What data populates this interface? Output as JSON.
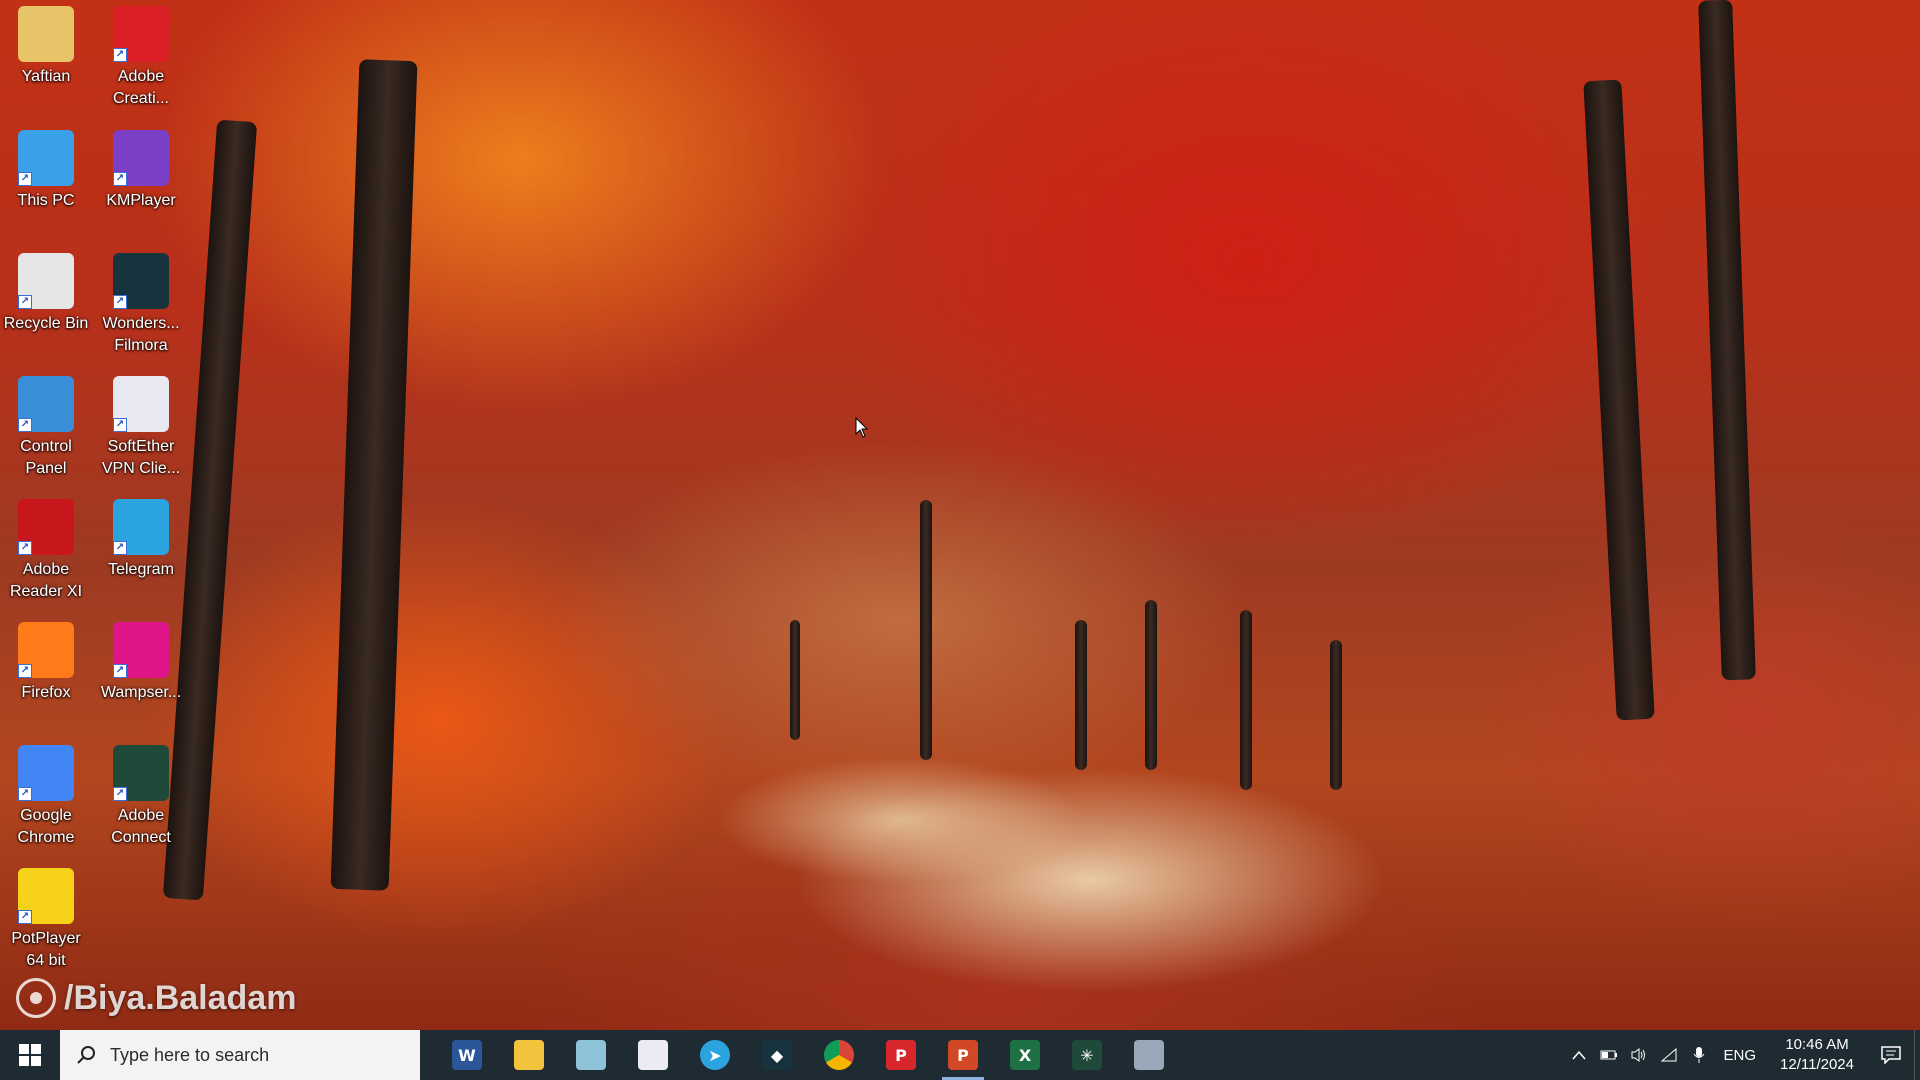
{
  "desktop": {
    "icons": [
      {
        "label": "Yaftian",
        "icon": "folder-user-icon",
        "color": "#e8c468"
      },
      {
        "label": "Adobe\nCreati...",
        "icon": "adobe-creative-cloud-icon",
        "color": "#da1f26"
      },
      {
        "label": "This PC",
        "icon": "this-pc-icon",
        "color": "#3aa0e8"
      },
      {
        "label": "KMPlayer",
        "icon": "kmplayer-icon",
        "color": "#7b3fc8"
      },
      {
        "label": "Recycle Bin",
        "icon": "recycle-bin-icon",
        "color": "#e6e6e6"
      },
      {
        "label": "Wonders...\nFilmora",
        "icon": "filmora-icon",
        "color": "#17333d"
      },
      {
        "label": "Control\nPanel",
        "icon": "control-panel-icon",
        "color": "#3b8fd9"
      },
      {
        "label": "SoftEther\nVPN Clie...",
        "icon": "softether-vpn-icon",
        "color": "#e8e8f0"
      },
      {
        "label": "Adobe\nReader XI",
        "icon": "adobe-reader-icon",
        "color": "#c8161d"
      },
      {
        "label": "Telegram",
        "icon": "telegram-icon",
        "color": "#2aa3df"
      },
      {
        "label": "Firefox",
        "icon": "firefox-icon",
        "color": "#ff7a18"
      },
      {
        "label": "Wampser...",
        "icon": "wampserver-icon",
        "color": "#e0158a"
      },
      {
        "label": "Google\nChrome",
        "icon": "chrome-icon",
        "color": "#4285f4"
      },
      {
        "label": "Adobe\nConnect",
        "icon": "adobe-connect-icon",
        "color": "#1f4a3a"
      },
      {
        "label": "PotPlayer\n64 bit",
        "icon": "potplayer-icon",
        "color": "#f7d21a"
      }
    ],
    "watermark": "/Biya.Baladam"
  },
  "taskbar": {
    "search_placeholder": "Type here to search",
    "pinned": [
      {
        "name": "word",
        "icon": "word-icon",
        "glyph": "W",
        "color": "#2b579a"
      },
      {
        "name": "file-explorer",
        "icon": "folder-icon",
        "glyph": "",
        "color": "#f2c33d"
      },
      {
        "name": "notepad",
        "icon": "notepad-icon",
        "glyph": "",
        "color": "#8fc3d9"
      },
      {
        "name": "softether",
        "icon": "softether-vpn-icon",
        "glyph": "",
        "color": "#ecebf3"
      },
      {
        "name": "telegram",
        "icon": "telegram-icon",
        "glyph": "➤",
        "color": "#2aa3df"
      },
      {
        "name": "filmora",
        "icon": "filmora-icon",
        "glyph": "◆",
        "color": "#17333d"
      },
      {
        "name": "chrome",
        "icon": "chrome-icon",
        "glyph": "",
        "color": "#4285f4"
      },
      {
        "name": "wps-presentation",
        "icon": "wps-presentation-icon",
        "glyph": "P",
        "color": "#d7262c"
      },
      {
        "name": "powerpoint",
        "icon": "powerpoint-icon",
        "glyph": "P",
        "color": "#d24726"
      },
      {
        "name": "excel",
        "icon": "excel-icon",
        "glyph": "X",
        "color": "#1e7145"
      },
      {
        "name": "adobe-connect",
        "icon": "adobe-connect-icon",
        "glyph": "✳",
        "color": "#1f4a3a"
      },
      {
        "name": "camera",
        "icon": "camera-icon",
        "glyph": "",
        "color": "#9aa7b8"
      }
    ],
    "active_index": 8,
    "tray": {
      "language": "ENG",
      "time": "10:46 AM",
      "date": "12/11/2024"
    }
  }
}
